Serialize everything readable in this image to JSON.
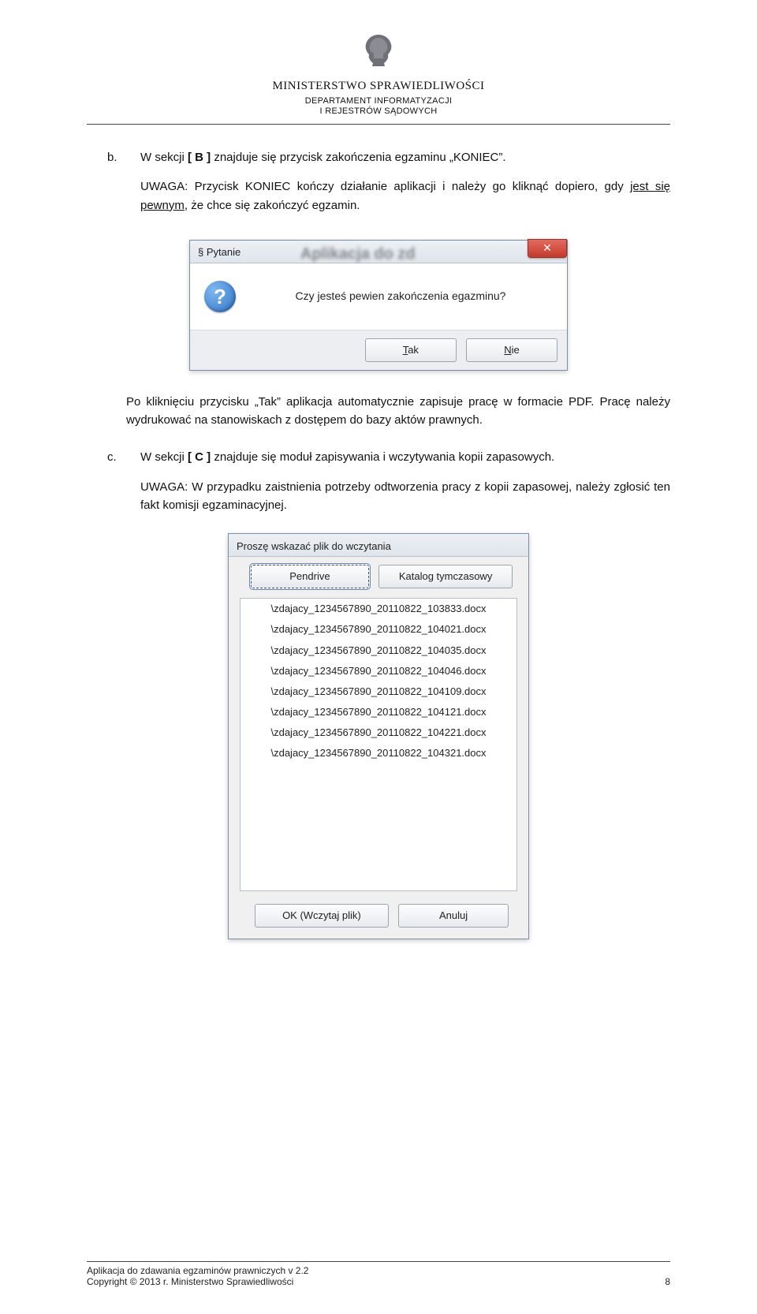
{
  "header": {
    "ministry": "MINISTERSTWO SPRAWIEDLIWOŚCI",
    "dept1": "DEPARTAMENT INFORMATYZACJI",
    "dept2": "I REJESTRÓW SĄDOWYCH"
  },
  "body": {
    "item_b": {
      "bullet": "b.",
      "text_before": "W sekcji ",
      "section": "[ B ]",
      "text_after": " znajduje się przycisk zakończenia egzaminu „KONIEC”.",
      "uwaga_label": "UWAGA:",
      "uwaga_before": " Przycisk KONIEC kończy działanie aplikacji i należy go kliknąć dopiero, gdy ",
      "uwaga_underlined": "jest się pewnym,",
      "uwaga_after": " że chce się zakończyć egzamin."
    },
    "after_dlg1_p1": "Po kliknięciu przycisku „Tak” aplikacja automatycznie zapisuje pracę w formacie PDF. Pracę należy wydrukować na stanowiskach z dostępem do bazy aktów prawnych.",
    "item_c": {
      "bullet": "c.",
      "text_before": "W sekcji ",
      "section": "[ C ]",
      "text_after": " znajduje się moduł zapisywania i wczytywania kopii zapasowych.",
      "uwaga_label": "UWAGA:",
      "uwaga_text": " W przypadku zaistnienia potrzeby odtworzenia pracy z kopii zapasowej, należy zgłosić ten fakt komisji egzaminacyjnej."
    }
  },
  "dialog1": {
    "title": "§ Pytanie",
    "bg_blur": "Aplikacja do zd",
    "close_glyph": "✕",
    "icon_glyph": "?",
    "message": "Czy jesteś pewien zakończenia egazminu?",
    "btn_yes_prefix": "",
    "btn_yes_hot": "T",
    "btn_yes_suffix": "ak",
    "btn_no_prefix": "",
    "btn_no_hot": "N",
    "btn_no_suffix": "ie"
  },
  "dialog2": {
    "title": "Proszę wskazać plik do wczytania",
    "btn_pendrive": "Pendrive",
    "btn_tempdir": "Katalog tymczasowy",
    "files": [
      "\\zdajacy_1234567890_20110822_103833.docx",
      "\\zdajacy_1234567890_20110822_104021.docx",
      "\\zdajacy_1234567890_20110822_104035.docx",
      "\\zdajacy_1234567890_20110822_104046.docx",
      "\\zdajacy_1234567890_20110822_104109.docx",
      "\\zdajacy_1234567890_20110822_104121.docx",
      "\\zdajacy_1234567890_20110822_104221.docx",
      "\\zdajacy_1234567890_20110822_104321.docx"
    ],
    "btn_ok": "OK (Wczytaj plik)",
    "btn_cancel": "Anuluj"
  },
  "footer": {
    "line1": "Aplikacja do zdawania egzaminów prawniczych v 2.2",
    "line2": "Copyright © 2013 r. Ministerstwo Sprawiedliwości",
    "page": "8"
  }
}
